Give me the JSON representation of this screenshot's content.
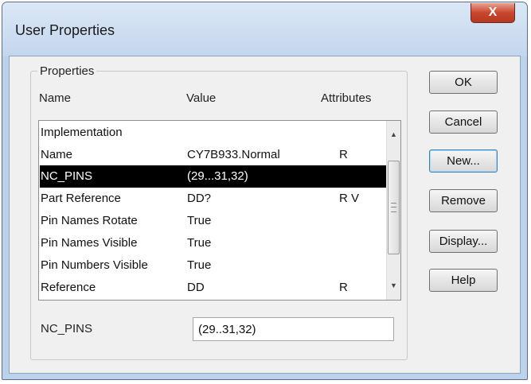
{
  "window": {
    "title": "User Properties",
    "close_label": "X"
  },
  "group": {
    "label": "Properties",
    "columns": {
      "name": "Name",
      "value": "Value",
      "attributes": "Attributes"
    }
  },
  "rows": [
    {
      "name": "Implementation",
      "value": "",
      "attr": ""
    },
    {
      "name": "Name",
      "value": "CY7B933.Normal",
      "attr": "R"
    },
    {
      "name": "NC_PINS",
      "value": "(29...31,32)",
      "attr": "",
      "selected": true
    },
    {
      "name": "Part Reference",
      "value": "DD?",
      "attr": "R V"
    },
    {
      "name": "Pin Names Rotate",
      "value": "True",
      "attr": ""
    },
    {
      "name": "Pin Names Visible",
      "value": "True",
      "attr": ""
    },
    {
      "name": "Pin Numbers Visible",
      "value": "True",
      "attr": ""
    },
    {
      "name": "Reference",
      "value": "DD",
      "attr": "R"
    }
  ],
  "scrollbar": {
    "up_icon": "scroll-up-arrow",
    "down_icon": "scroll-down-arrow"
  },
  "edit": {
    "label": "NC_PINS",
    "value": "(29..31,32)"
  },
  "buttons": {
    "ok": "OK",
    "cancel": "Cancel",
    "new": "New...",
    "remove": "Remove",
    "display": "Display...",
    "help": "Help"
  },
  "colors": {
    "selection": "#000000",
    "title_bar": "#c3d6ee",
    "close": "#c9462e"
  }
}
